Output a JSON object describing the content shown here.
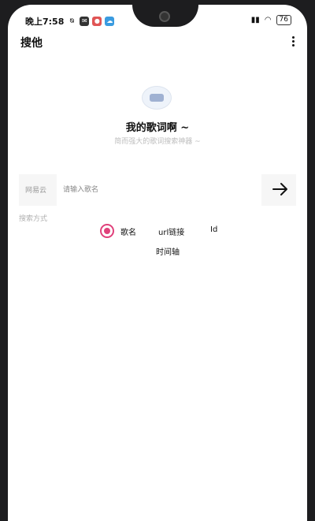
{
  "status_bar": {
    "time": "晚上7:58",
    "battery": "76"
  },
  "header": {
    "title": "搜他"
  },
  "hero": {
    "title": "我的歌词啊 ~",
    "subtitle": "简而强大的歌词搜索神器 ~"
  },
  "search": {
    "source_label": "网易云",
    "placeholder": "请输入歌名"
  },
  "search_mode": {
    "label": "搜索方式",
    "options": [
      "歌名",
      "url链接",
      "Id",
      "时间轴"
    ],
    "selected": "歌名"
  },
  "colors": {
    "accent": "#e0417b"
  }
}
